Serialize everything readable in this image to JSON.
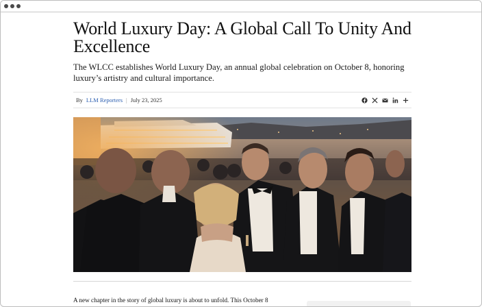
{
  "article": {
    "headline": "World Luxury Day: A Global Call To Unity And Excellence",
    "dek": "The WLCC establishes World Luxury Day, an annual global celebration on October 8, honoring luxury’s artistry and cultural importance.",
    "byline_prefix": "By",
    "author": "LLM Reporters",
    "separator": "|",
    "date": "July 23, 2025",
    "share_icons": [
      "facebook-icon",
      "x-icon",
      "email-icon",
      "linkedin-icon",
      "plus-icon"
    ],
    "hero_image_alt": "Guests in black tie at an evening harbor reception with a superyacht behind",
    "body_first_line": "A new chapter in the story of global luxury is about to unfold. This October 8"
  },
  "colors": {
    "link": "#2a5db0",
    "rule": "#e2e2e2"
  }
}
